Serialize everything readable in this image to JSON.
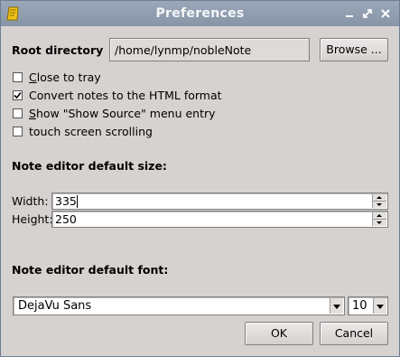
{
  "window": {
    "title": "Preferences"
  },
  "root_directory": {
    "label": "Root directory",
    "path": "/home/lynmp/nobleNote",
    "browse_label": "Browse ..."
  },
  "checkboxes": [
    {
      "label_first": "C",
      "label_rest": "lose to tray",
      "checked": false
    },
    {
      "label_first": "",
      "label_rest": "Convert notes to the HTML format",
      "checked": true
    },
    {
      "label_first": "S",
      "label_rest": "how \"Show Source\" menu entry",
      "checked": false
    },
    {
      "label_first": "",
      "label_rest": "touch screen scrolling",
      "checked": false
    }
  ],
  "size_section": {
    "heading": "Note editor default size:",
    "width_label": "Width:",
    "width_value": "335",
    "height_label": "Height:",
    "height_value": "250"
  },
  "font_section": {
    "heading": "Note editor default font:",
    "font_name": "DejaVu Sans",
    "font_size": "10"
  },
  "buttons": {
    "ok": "OK",
    "cancel": "Cancel"
  }
}
